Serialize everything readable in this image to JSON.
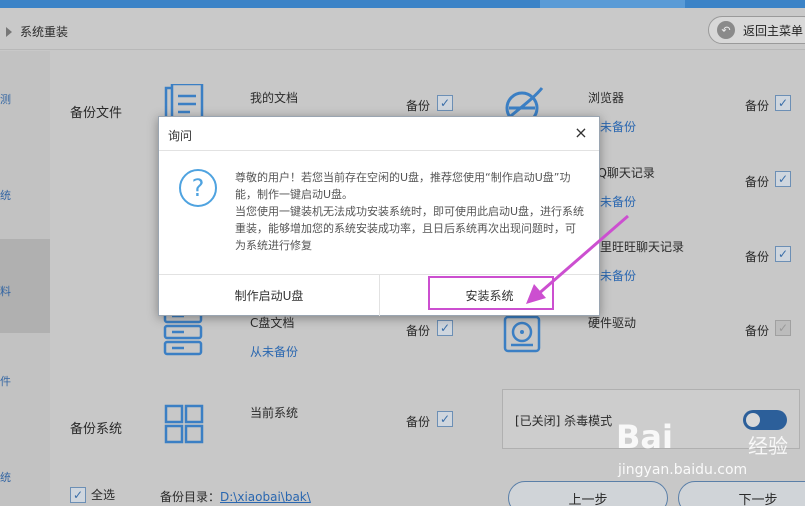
{
  "header": {
    "breadcrumb": "系统重装",
    "back_button": "返回主菜单"
  },
  "sidebar": {
    "items": [
      {
        "label": "测"
      },
      {
        "label": "统"
      },
      {
        "label": "料"
      },
      {
        "label": "件"
      },
      {
        "label": "统"
      }
    ]
  },
  "backup_files": {
    "section_label": "备份文件",
    "backup_label": "备份",
    "left_items": [
      {
        "title": "我的文档",
        "status": ""
      },
      {
        "title": "C盘文档",
        "status": "从未备份"
      }
    ],
    "right_items": [
      {
        "title": "浏览器",
        "status": "从未备份"
      },
      {
        "title": "QQ聊天记录",
        "status": "从未备份"
      },
      {
        "title": "阿里旺旺聊天记录",
        "status": "从未备份"
      },
      {
        "title": "硬件驱动",
        "status": ""
      }
    ]
  },
  "backup_system": {
    "section_label": "备份系统",
    "item_title": "当前系统",
    "backup_label": "备份",
    "kill_mode_label": "[已关闭] 杀毒模式"
  },
  "footer": {
    "select_all": "全选",
    "backup_dir_label": "备份目录：",
    "backup_dir_path": "D:\\xiaobai\\bak\\",
    "prev_button": "上一步",
    "next_button": "下一步"
  },
  "dialog": {
    "title": "询问",
    "close_symbol": "×",
    "icon_symbol": "?",
    "message_line1": "尊敬的用户！若您当前存在空闲的U盘，推荐您使用“制作启动U盘”功能，制作一键启动U盘。",
    "message_line2": "当您使用一键装机无法成功安装系统时，即可使用此启动U盘，进行系统重装，能够增加您的系统安装成功率，且日后系统再次出现问题时，可为系统进行修复",
    "btn_make_usb": "制作启动U盘",
    "btn_install": "安装系统"
  },
  "watermark": {
    "brand": "Bai",
    "brand_suffix": "经验",
    "url": "jingyan.baidu.com"
  },
  "colors": {
    "accent": "#3b83c7",
    "highlight": "#cc4fd0",
    "link": "#2a67b0"
  }
}
